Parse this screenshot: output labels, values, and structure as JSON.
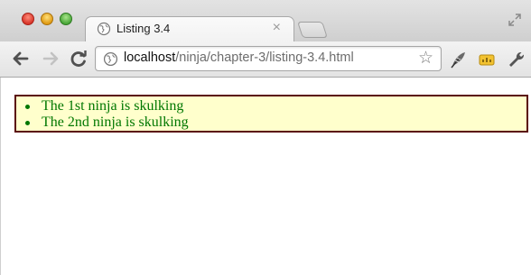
{
  "tab": {
    "title": "Listing 3.4",
    "close_glyph": "×"
  },
  "address_bar": {
    "host": "localhost",
    "path": "/ninja/chapter-3/listing-3.4.html"
  },
  "icons": {
    "back": "back-arrow-icon",
    "forward": "forward-arrow-icon",
    "reload": "reload-icon",
    "bookmark": "star-icon",
    "extension1": "feather-icon",
    "extension2": "yellow-badge-icon",
    "settings": "wrench-icon",
    "fullscreen": "fullscreen-icon"
  },
  "results": {
    "items": [
      {
        "text": "The 1st ninja is skulking"
      },
      {
        "text": "The 2nd ninja is skulking"
      }
    ]
  },
  "colors": {
    "result_text": "#007700",
    "result_background": "#ffffcc",
    "result_border": "#5a0a0a"
  }
}
